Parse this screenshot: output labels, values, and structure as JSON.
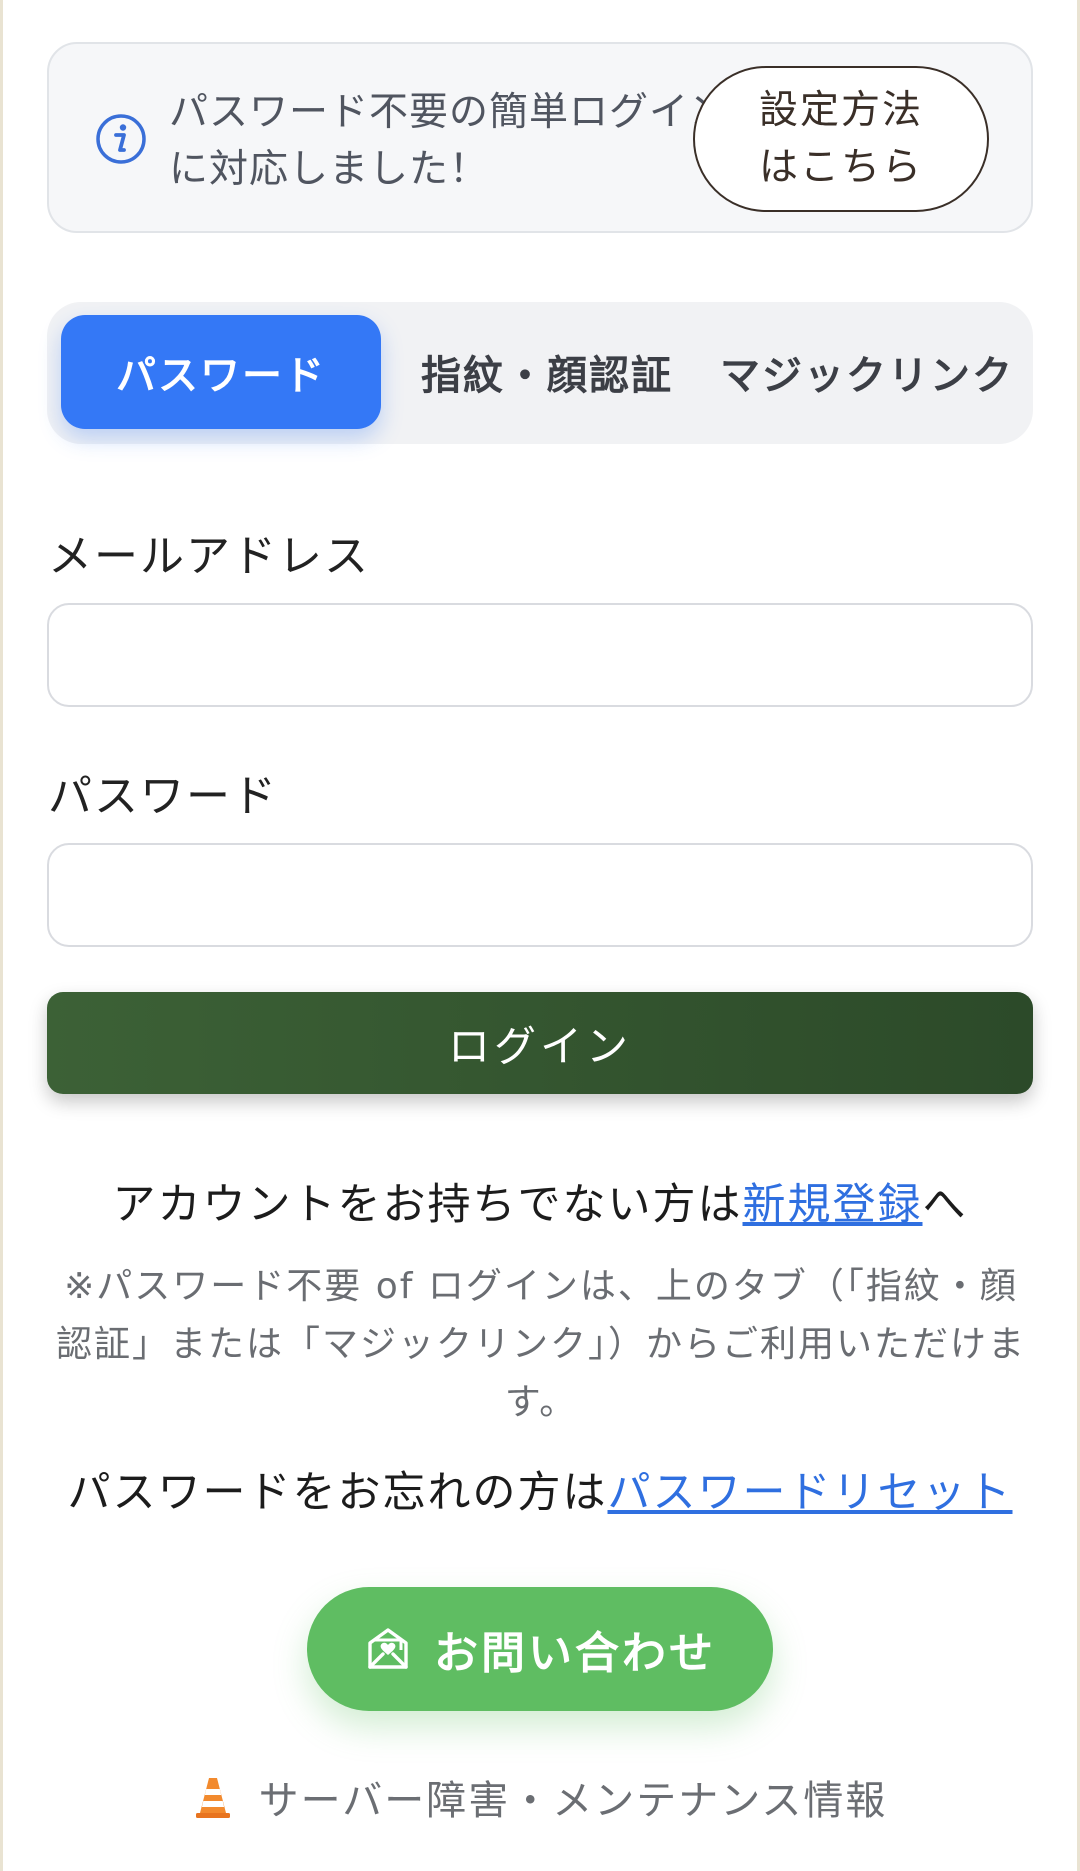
{
  "notice": {
    "text": "パスワード不要の簡単ログインに対応しました！",
    "button_label": "設定方法はこちら",
    "icon": "info-circle-icon",
    "icon_color": "#3a6fd8"
  },
  "tabs": [
    {
      "label": "パスワード",
      "active": true
    },
    {
      "label": "指紋・顔認証",
      "active": false
    },
    {
      "label": "マジックリンク",
      "active": false
    }
  ],
  "form": {
    "email_label": "メールアドレス",
    "email_value": "",
    "password_label": "パスワード",
    "password_value": "",
    "login_button": "ログイン"
  },
  "register": {
    "prefix": "アカウントをお持ちでない方は",
    "link": "新規登録",
    "suffix": "へ"
  },
  "note": "※パスワード不要 of ログインは、上のタブ（「指紋・顔認証」または「マジックリンク」）からご利用いただけます。",
  "reset": {
    "prefix": "パスワードをお忘れの方は",
    "link": "パスワードリセット"
  },
  "contact": {
    "label": "お問い合わせ",
    "icon": "mail-heart-icon"
  },
  "status": {
    "label": "サーバー障害・メンテナンス情報",
    "icon": "traffic-cone-icon"
  },
  "colors": {
    "tab_active": "#3478f6",
    "login_button": "#2f4f2c",
    "contact_button": "#5fbd62",
    "link": "#2f6fe0"
  }
}
